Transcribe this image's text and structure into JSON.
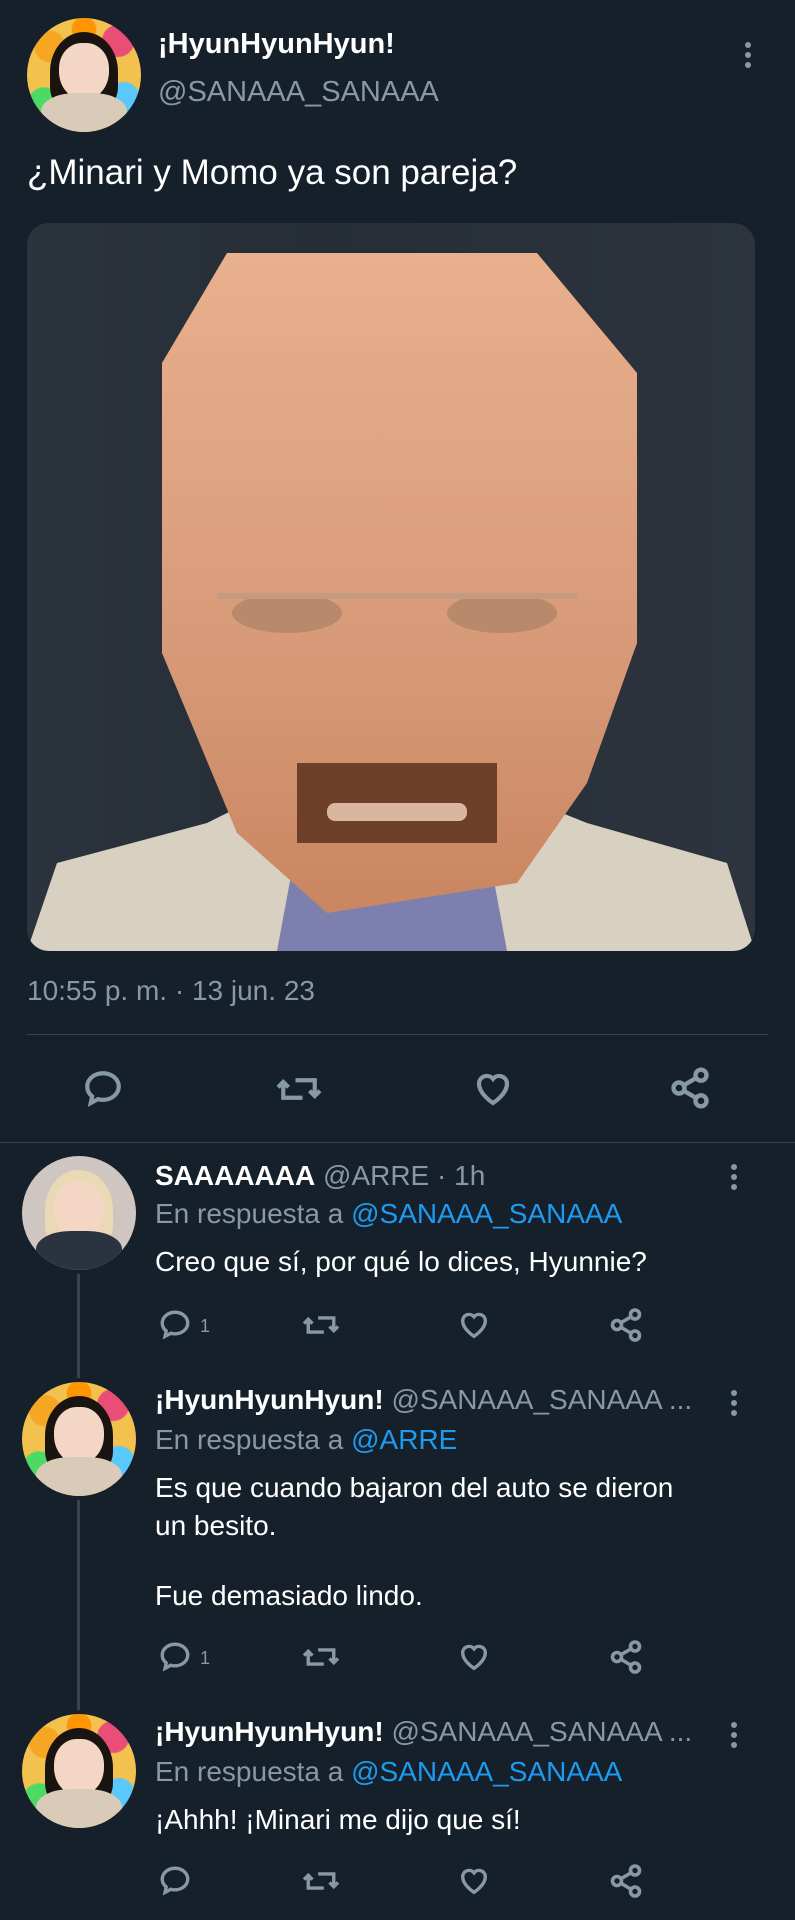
{
  "tweet": {
    "name": "¡HyunHyunHyun!",
    "handle": "@SANAAA_SANAAA",
    "text": "¿Minari y Momo ya son pareja?",
    "timestamp": "10:55 p. m. · 13 jun. 23",
    "media": {
      "description_icon": "meme-image"
    }
  },
  "replies": [
    {
      "name": "SAAAAAAA",
      "handle": "@ARRE",
      "dot_time": "· 1h",
      "reply_prefix": "En respuesta a",
      "reply_to": "@SANAAA_SANAAA",
      "text_lines": [
        "Creo que sí, por qué lo dices, Hyunnie?"
      ],
      "reply_count": "1"
    },
    {
      "name": "¡HyunHyunHyun!",
      "handle": "@SANAAA_SANAAA ...",
      "reply_prefix": "En respuesta a",
      "reply_to": "@ARRE",
      "text_lines": [
        "Es que cuando bajaron del auto se dieron",
        "un besito.",
        "Fue demasiado lindo."
      ],
      "reply_count": "1"
    },
    {
      "name": "¡HyunHyunHyun!",
      "handle": "@SANAAA_SANAAA ...",
      "reply_prefix": "En respuesta a",
      "reply_to": "@SANAAA_SANAAA",
      "text_lines": [
        "¡Ahhh! ¡Minari me dijo que sí!"
      ],
      "reply_count": ""
    }
  ],
  "colors": {
    "background": "#15202b",
    "link": "#1d9bf0",
    "muted": "#8899a6",
    "divider": "#38444d"
  }
}
